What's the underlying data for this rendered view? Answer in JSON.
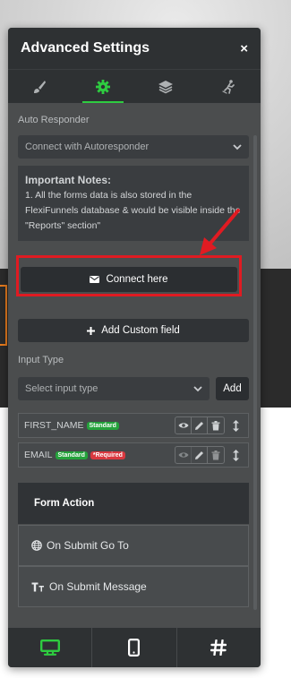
{
  "panel": {
    "title": "Advanced Settings",
    "close_label": "×"
  },
  "tabs": [
    {
      "icon": "paintbrush-icon",
      "active": false
    },
    {
      "icon": "gear-icon",
      "active": true
    },
    {
      "icon": "layers-icon",
      "active": false
    },
    {
      "icon": "running-figure-icon",
      "active": false
    }
  ],
  "auto_responder": {
    "label": "Auto Responder",
    "select_value": "Connect with Autoresponder",
    "notes_title": "Important Notes:",
    "notes_body": "1. All the forms data is also stored in the FlexiFunnels database & would be visible inside the \"Reports\" section\"",
    "connect_label": "Connect here"
  },
  "custom_field": {
    "add_label": "Add Custom field"
  },
  "input_type": {
    "label": "Input Type",
    "placeholder": "Select input type",
    "add_label": "Add"
  },
  "fields": [
    {
      "name": "FIRST_NAME",
      "badges": [
        "Standard"
      ]
    },
    {
      "name": "EMAIL",
      "badges": [
        "Standard",
        "*Required"
      ]
    }
  ],
  "form_action": {
    "title": "Form Action",
    "items": [
      "On Submit Go To",
      "On Submit Message"
    ]
  },
  "colors": {
    "accent": "#2ecc40",
    "highlight": "#e01b22",
    "panel_bg": "#4b4d4e"
  }
}
